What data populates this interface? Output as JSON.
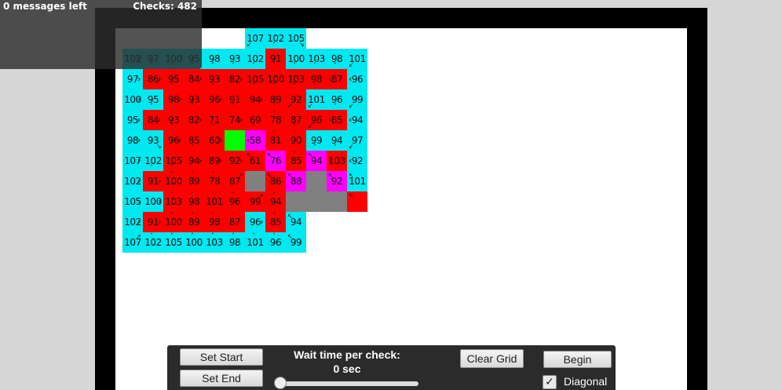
{
  "status": {
    "messages_left": "0 messages left",
    "checks": "Checks: 482"
  },
  "controls": {
    "set_start": "Set Start",
    "set_end": "Set End",
    "wait_label": "Wait time per check:",
    "wait_value": "0 sec",
    "wait_seconds": 0,
    "clear_grid": "Clear Grid",
    "begin": "Begin",
    "diagonal_label": "Diagonal",
    "diagonal_checked": true
  },
  "colors": {
    "open": "#00e8f0",
    "closed": "#ff0000",
    "path": "#ff00ff",
    "start": "#00ff00",
    "wall": "#808080"
  },
  "grid": {
    "origin_row": -1,
    "origin_col": 3,
    "cells": [
      {
        "r": -1,
        "c": 3,
        "t": "open",
        "v": "107",
        "a": "sw"
      },
      {
        "r": -1,
        "c": 4,
        "t": "open",
        "v": "102",
        "a": "s"
      },
      {
        "r": -1,
        "c": 5,
        "t": "open",
        "v": "105",
        "a": "se"
      },
      {
        "r": 0,
        "c": -3,
        "t": "open",
        "v": "102",
        "a": "e"
      },
      {
        "r": 0,
        "c": -2,
        "t": "open",
        "v": "97",
        "a": "s"
      },
      {
        "r": 0,
        "c": -1,
        "t": "open",
        "v": "100",
        "a": "s"
      },
      {
        "r": 0,
        "c": 0,
        "t": "open",
        "v": "95",
        "a": "s"
      },
      {
        "r": 0,
        "c": 1,
        "t": "open",
        "v": "98",
        "a": "s"
      },
      {
        "r": 0,
        "c": 2,
        "t": "open",
        "v": "93",
        "a": "s"
      },
      {
        "r": 0,
        "c": 3,
        "t": "open",
        "v": "102",
        "a": "s"
      },
      {
        "r": 0,
        "c": 4,
        "t": "closed",
        "v": "91",
        "a": "s"
      },
      {
        "r": 0,
        "c": 5,
        "t": "open",
        "v": "100",
        "a": "s"
      },
      {
        "r": 0,
        "c": 6,
        "t": "open",
        "v": "103",
        "a": "s"
      },
      {
        "r": 0,
        "c": 7,
        "t": "open",
        "v": "98",
        "a": "s"
      },
      {
        "r": 0,
        "c": 8,
        "t": "open",
        "v": "101",
        "a": "sw"
      },
      {
        "r": 1,
        "c": -3,
        "t": "open",
        "v": "97",
        "a": "e"
      },
      {
        "r": 1,
        "c": -2,
        "t": "closed",
        "v": "86",
        "a": "e"
      },
      {
        "r": 1,
        "c": -1,
        "t": "closed",
        "v": "95",
        "a": "s"
      },
      {
        "r": 1,
        "c": 0,
        "t": "closed",
        "v": "84",
        "a": "e"
      },
      {
        "r": 1,
        "c": 1,
        "t": "closed",
        "v": "93",
        "a": "s"
      },
      {
        "r": 1,
        "c": 2,
        "t": "closed",
        "v": "82",
        "a": "e"
      },
      {
        "r": 1,
        "c": 3,
        "t": "closed",
        "v": "105",
        "a": "s"
      },
      {
        "r": 1,
        "c": 4,
        "t": "closed",
        "v": "100",
        "a": "s"
      },
      {
        "r": 1,
        "c": 5,
        "t": "closed",
        "v": "103",
        "a": "s"
      },
      {
        "r": 1,
        "c": 6,
        "t": "closed",
        "v": "98",
        "a": "s"
      },
      {
        "r": 1,
        "c": 7,
        "t": "closed",
        "v": "87",
        "a": "w"
      },
      {
        "r": 1,
        "c": 8,
        "t": "open",
        "v": "96",
        "a": "w"
      },
      {
        "r": 2,
        "c": -3,
        "t": "open",
        "v": "100",
        "a": "e"
      },
      {
        "r": 2,
        "c": -2,
        "t": "open",
        "v": "95",
        "a": "s"
      },
      {
        "r": 2,
        "c": -1,
        "t": "closed",
        "v": "98",
        "a": "e"
      },
      {
        "r": 2,
        "c": 0,
        "t": "closed",
        "v": "93",
        "a": "s"
      },
      {
        "r": 2,
        "c": 1,
        "t": "closed",
        "v": "96",
        "a": "e"
      },
      {
        "r": 2,
        "c": 2,
        "t": "closed",
        "v": "91",
        "a": "s"
      },
      {
        "r": 2,
        "c": 3,
        "t": "closed",
        "v": "94",
        "a": "e"
      },
      {
        "r": 2,
        "c": 4,
        "t": "closed",
        "v": "89",
        "a": "s"
      },
      {
        "r": 2,
        "c": 5,
        "t": "closed",
        "v": "92",
        "a": "sw"
      },
      {
        "r": 2,
        "c": 6,
        "t": "open",
        "v": "101",
        "a": "sw"
      },
      {
        "r": 2,
        "c": 7,
        "t": "open",
        "v": "96",
        "a": "s"
      },
      {
        "r": 2,
        "c": 8,
        "t": "open",
        "v": "99",
        "a": "sw"
      },
      {
        "r": 3,
        "c": -3,
        "t": "open",
        "v": "95",
        "a": "e"
      },
      {
        "r": 3,
        "c": -2,
        "t": "closed",
        "v": "84",
        "a": "e"
      },
      {
        "r": 3,
        "c": -1,
        "t": "closed",
        "v": "93",
        "a": "s"
      },
      {
        "r": 3,
        "c": 0,
        "t": "closed",
        "v": "82",
        "a": "e"
      },
      {
        "r": 3,
        "c": 1,
        "t": "closed",
        "v": "71",
        "a": "s"
      },
      {
        "r": 3,
        "c": 2,
        "t": "closed",
        "v": "74",
        "a": "e"
      },
      {
        "r": 3,
        "c": 3,
        "t": "closed",
        "v": "69",
        "a": "s"
      },
      {
        "r": 3,
        "c": 4,
        "t": "closed",
        "v": "78",
        "a": "n"
      },
      {
        "r": 3,
        "c": 5,
        "t": "closed",
        "v": "87",
        "a": "s"
      },
      {
        "r": 3,
        "c": 6,
        "t": "closed",
        "v": "96",
        "a": "sw"
      },
      {
        "r": 3,
        "c": 7,
        "t": "closed",
        "v": "85",
        "a": "w"
      },
      {
        "r": 3,
        "c": 8,
        "t": "open",
        "v": "94",
        "a": "w"
      },
      {
        "r": 4,
        "c": -3,
        "t": "open",
        "v": "98",
        "a": "e"
      },
      {
        "r": 4,
        "c": -2,
        "t": "open",
        "v": "93",
        "a": "se"
      },
      {
        "r": 4,
        "c": -1,
        "t": "closed",
        "v": "96",
        "a": "e"
      },
      {
        "r": 4,
        "c": 0,
        "t": "closed",
        "v": "85",
        "a": "s"
      },
      {
        "r": 4,
        "c": 1,
        "t": "closed",
        "v": "60",
        "a": "e"
      },
      {
        "r": 4,
        "c": 2,
        "t": "start",
        "v": "",
        "a": ""
      },
      {
        "r": 4,
        "c": 3,
        "t": "path",
        "v": "58",
        "a": "w"
      },
      {
        "r": 4,
        "c": 4,
        "t": "closed",
        "v": "81",
        "a": "n"
      },
      {
        "r": 4,
        "c": 5,
        "t": "closed",
        "v": "90",
        "a": "n"
      },
      {
        "r": 4,
        "c": 6,
        "t": "open",
        "v": "99",
        "a": "s"
      },
      {
        "r": 4,
        "c": 7,
        "t": "open",
        "v": "94",
        "a": "s"
      },
      {
        "r": 4,
        "c": 8,
        "t": "open",
        "v": "97",
        "a": "sw"
      },
      {
        "r": 5,
        "c": -3,
        "t": "open",
        "v": "107",
        "a": "e"
      },
      {
        "r": 5,
        "c": -2,
        "t": "open",
        "v": "102",
        "a": "s"
      },
      {
        "r": 5,
        "c": -1,
        "t": "closed",
        "v": "105",
        "a": "s"
      },
      {
        "r": 5,
        "c": 0,
        "t": "closed",
        "v": "94",
        "a": "e"
      },
      {
        "r": 5,
        "c": 1,
        "t": "closed",
        "v": "89",
        "a": "e"
      },
      {
        "r": 5,
        "c": 2,
        "t": "closed",
        "v": "92",
        "a": "e"
      },
      {
        "r": 5,
        "c": 3,
        "t": "closed",
        "v": "61",
        "a": "nw"
      },
      {
        "r": 5,
        "c": 4,
        "t": "path",
        "v": "76",
        "a": "nw"
      },
      {
        "r": 5,
        "c": 5,
        "t": "closed",
        "v": "85",
        "a": "n"
      },
      {
        "r": 5,
        "c": 6,
        "t": "path",
        "v": "94",
        "a": "nw"
      },
      {
        "r": 5,
        "c": 7,
        "t": "closed",
        "v": "103",
        "a": "w"
      },
      {
        "r": 5,
        "c": 8,
        "t": "open",
        "v": "92",
        "a": "w"
      },
      {
        "r": 6,
        "c": -3,
        "t": "open",
        "v": "102",
        "a": "e"
      },
      {
        "r": 6,
        "c": -2,
        "t": "closed",
        "v": "91",
        "a": "e"
      },
      {
        "r": 6,
        "c": -1,
        "t": "closed",
        "v": "100",
        "a": "n"
      },
      {
        "r": 6,
        "c": 0,
        "t": "closed",
        "v": "89",
        "a": "n"
      },
      {
        "r": 6,
        "c": 1,
        "t": "closed",
        "v": "78",
        "a": "n"
      },
      {
        "r": 6,
        "c": 2,
        "t": "closed",
        "v": "87",
        "a": "ne"
      },
      {
        "r": 6,
        "c": 3,
        "t": "wall",
        "v": "",
        "a": ""
      },
      {
        "r": 6,
        "c": 4,
        "t": "closed",
        "v": "86",
        "a": "nw"
      },
      {
        "r": 6,
        "c": 5,
        "t": "path",
        "v": "88",
        "a": "nw"
      },
      {
        "r": 6,
        "c": 6,
        "t": "wall",
        "v": "",
        "a": ""
      },
      {
        "r": 6,
        "c": 7,
        "t": "path",
        "v": "92",
        "a": "nw"
      },
      {
        "r": 6,
        "c": 8,
        "t": "open",
        "v": "101",
        "a": "nw"
      },
      {
        "r": 7,
        "c": -3,
        "t": "open",
        "v": "105",
        "a": "e"
      },
      {
        "r": 7,
        "c": -2,
        "t": "open",
        "v": "100",
        "a": "e"
      },
      {
        "r": 7,
        "c": -1,
        "t": "closed",
        "v": "103",
        "a": "n"
      },
      {
        "r": 7,
        "c": 0,
        "t": "closed",
        "v": "98",
        "a": "n"
      },
      {
        "r": 7,
        "c": 1,
        "t": "closed",
        "v": "101",
        "a": "n"
      },
      {
        "r": 7,
        "c": 2,
        "t": "closed",
        "v": "96",
        "a": "n"
      },
      {
        "r": 7,
        "c": 3,
        "t": "closed",
        "v": "99",
        "a": "ne"
      },
      {
        "r": 7,
        "c": 4,
        "t": "closed",
        "v": "94",
        "a": "n"
      },
      {
        "r": 7,
        "c": 5,
        "t": "wall",
        "v": "",
        "a": ""
      },
      {
        "r": 7,
        "c": 6,
        "t": "wall",
        "v": "",
        "a": ""
      },
      {
        "r": 7,
        "c": 7,
        "t": "wall",
        "v": "",
        "a": ""
      },
      {
        "r": 7,
        "c": 8,
        "t": "closed",
        "v": "",
        "a": "nw"
      },
      {
        "r": 8,
        "c": -3,
        "t": "open",
        "v": "102",
        "a": "e"
      },
      {
        "r": 8,
        "c": -2,
        "t": "closed",
        "v": "91",
        "a": "e"
      },
      {
        "r": 8,
        "c": -1,
        "t": "closed",
        "v": "100",
        "a": "n"
      },
      {
        "r": 8,
        "c": 0,
        "t": "closed",
        "v": "89",
        "a": "n"
      },
      {
        "r": 8,
        "c": 1,
        "t": "closed",
        "v": "98",
        "a": "n"
      },
      {
        "r": 8,
        "c": 2,
        "t": "closed",
        "v": "87",
        "a": "n"
      },
      {
        "r": 8,
        "c": 3,
        "t": "open",
        "v": "96",
        "a": "e"
      },
      {
        "r": 8,
        "c": 4,
        "t": "closed",
        "v": "85",
        "a": "n"
      },
      {
        "r": 8,
        "c": 5,
        "t": "open",
        "v": "94",
        "a": "nw"
      },
      {
        "r": 9,
        "c": -3,
        "t": "open",
        "v": "107",
        "a": "ne"
      },
      {
        "r": 9,
        "c": -2,
        "t": "open",
        "v": "102",
        "a": "n"
      },
      {
        "r": 9,
        "c": -1,
        "t": "open",
        "v": "105",
        "a": "n"
      },
      {
        "r": 9,
        "c": 0,
        "t": "open",
        "v": "100",
        "a": "n"
      },
      {
        "r": 9,
        "c": 1,
        "t": "open",
        "v": "103",
        "a": "n"
      },
      {
        "r": 9,
        "c": 2,
        "t": "open",
        "v": "98",
        "a": "n"
      },
      {
        "r": 9,
        "c": 3,
        "t": "open",
        "v": "101",
        "a": "n"
      },
      {
        "r": 9,
        "c": 4,
        "t": "open",
        "v": "96",
        "a": "n"
      },
      {
        "r": 9,
        "c": 5,
        "t": "open",
        "v": "99",
        "a": "nw"
      }
    ]
  }
}
